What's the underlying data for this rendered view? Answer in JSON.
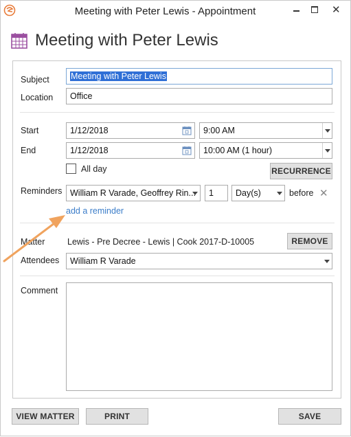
{
  "window": {
    "title": "Meeting with Peter Lewis - Appointment",
    "close_glyph": "✕"
  },
  "header": {
    "title": "Meeting with Peter Lewis"
  },
  "form": {
    "subject_label": "Subject",
    "subject_value": "Meeting with Peter Lewis",
    "location_label": "Location",
    "location_value": "Office",
    "start_label": "Start",
    "start_date": "1/12/2018",
    "start_time": "9:00 AM",
    "end_label": "End",
    "end_date": "1/12/2018",
    "end_time": "10:00 AM (1 hour)",
    "allday_label": "All day",
    "allday_checked": false,
    "recurrence_button": "RECURRENCE",
    "reminders_label": "Reminders",
    "reminders_value": "William R Varade, Geoffrey Rin...",
    "reminder_count": "1",
    "reminder_unit": "Day(s)",
    "reminder_before": "before",
    "reminder_remove_glyph": "✕",
    "add_reminder_link": "add a reminder",
    "matter_label": "Matter",
    "matter_value": "Lewis - Pre Decree - Lewis | Cook 2017-D-10005",
    "remove_button": "REMOVE",
    "attendees_label": "Attendees",
    "attendees_value": "William R Varade",
    "comment_label": "Comment",
    "comment_value": ""
  },
  "footer": {
    "view_matter_button": "VIEW MATTER",
    "print_button": "PRINT",
    "save_button": "SAVE"
  },
  "colors": {
    "accent_link": "#3b7dc9",
    "annotation_arrow": "#f0a35e",
    "calendar_icon": "#9b4fa0",
    "selection": "#2f6fd6"
  }
}
